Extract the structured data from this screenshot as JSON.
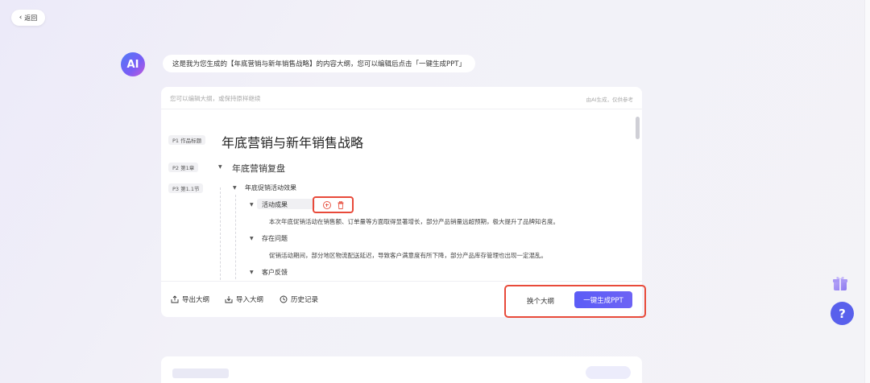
{
  "nav": {
    "back_label": "返回"
  },
  "ai": {
    "avatar_text": "AI",
    "message": "这是我为您生成的【年底营销与新年销售战略】的内容大纲，您可以编辑后点击「一键生成PPT」"
  },
  "editor": {
    "hint": "您可以编辑大纲，或保持原样继续",
    "disclaimer": "由AI生成，仅供参考",
    "title_tag": "P1 作品标题",
    "title": "年底营销与新年销售战略",
    "chapter_tag": "P2 第1章",
    "chapter_title": "年底营销复盘",
    "section_tag": "P3 第1.1节",
    "section_title": "年底促销活动效果",
    "items": [
      {
        "title": "活动成果",
        "text": "本次年底促销活动在销售额、订单量等方面取得显著增长，部分产品销量远超预期，极大提升了品牌知名度。"
      },
      {
        "title": "存在问题",
        "text": "促销活动期间，部分地区物流配送延迟，导致客户满意度有所下降，部分产品库存管理也出现一定混乱。"
      },
      {
        "title": "客户反馈",
        "text": ""
      }
    ]
  },
  "footer": {
    "export_label": "导出大纲",
    "import_label": "导入大纲",
    "history_label": "历史记录",
    "change_label": "换个大纲",
    "generate_label": "一键生成PPT"
  },
  "floating": {
    "help_label": "?"
  },
  "colors": {
    "accent": "#5b5cf6",
    "highlight_border": "#e84a3a"
  }
}
